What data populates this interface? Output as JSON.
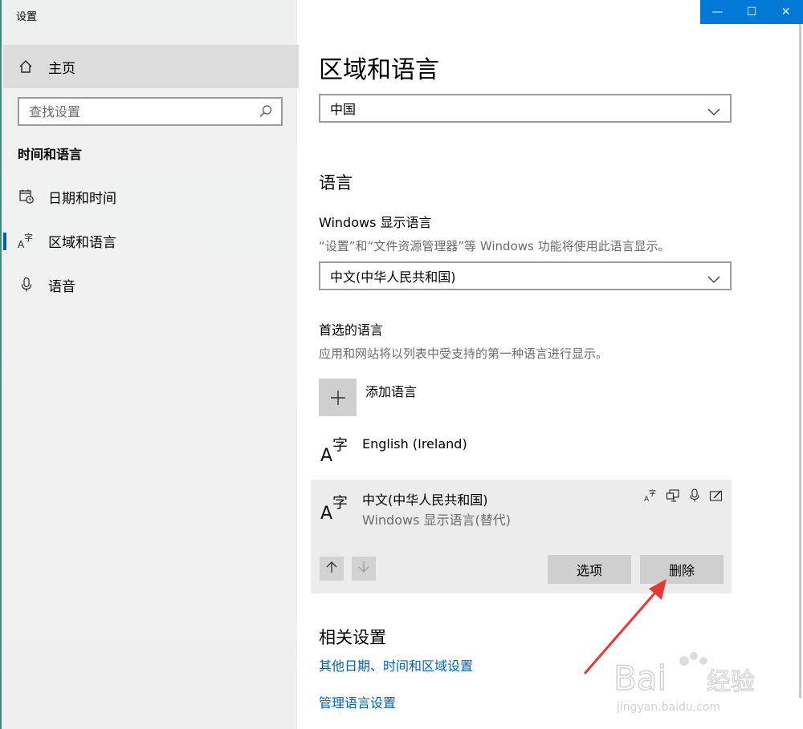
{
  "window": {
    "title": "设置",
    "minimize": "—",
    "maximize": "☐",
    "close": "✕"
  },
  "sidebar": {
    "home_label": "主页",
    "search_placeholder": "查找设置",
    "section_title": "时间和语言",
    "items": [
      {
        "label": "日期和时间",
        "icon": "calendar-clock-icon"
      },
      {
        "label": "区域和语言",
        "icon": "language-icon",
        "active": true
      },
      {
        "label": "语音",
        "icon": "microphone-icon"
      }
    ]
  },
  "main": {
    "title": "区域和语言",
    "region_value": "中国",
    "language_heading": "语言",
    "display_language_label": "Windows 显示语言",
    "display_language_desc": "“设置”和“文件资源管理器”等 Windows 功能将使用此语言显示。",
    "display_language_value": "中文(中华人民共和国)",
    "preferred_label": "首选的语言",
    "preferred_desc": "应用和网站将以列表中受支持的第一种语言进行显示。",
    "add_language_label": "添加语言",
    "languages": [
      {
        "name": "English (Ireland)",
        "sub": ""
      },
      {
        "name": "中文(中华人民共和国)",
        "sub": "Windows 显示语言(替代)"
      }
    ],
    "options_button": "选项",
    "remove_button": "删除",
    "related_heading": "相关设置",
    "related_links": [
      "其他日期、时间和区域设置",
      "管理语言设置"
    ]
  },
  "watermark": {
    "brand": "Bai",
    "brand_cn": "经验",
    "url": "jingyan.baidu.com"
  },
  "colors": {
    "accent": "#0078d7",
    "link": "#0063b1",
    "annotation": "#e53935"
  }
}
